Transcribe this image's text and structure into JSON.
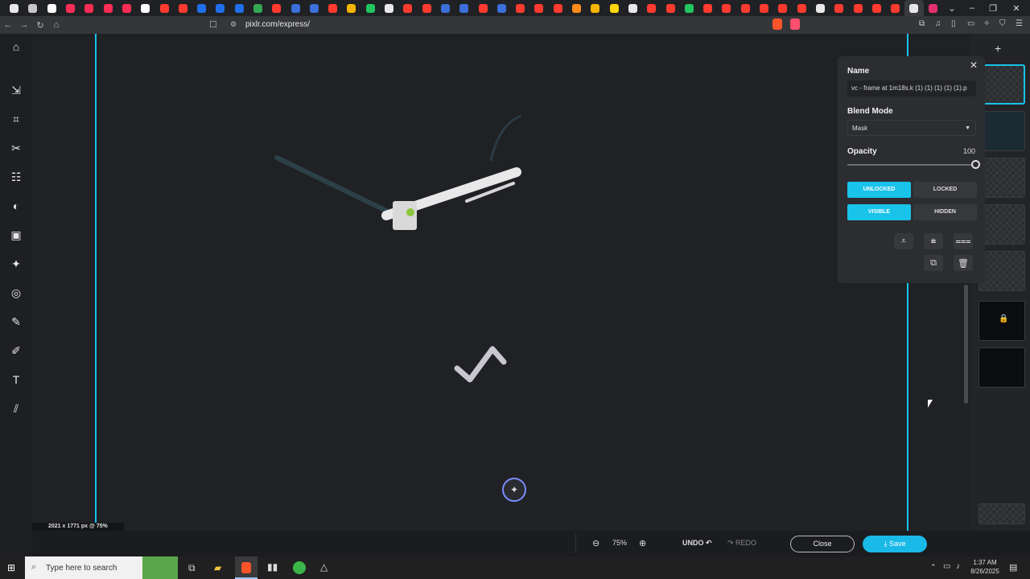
{
  "browser": {
    "url": "pixlr.com/express/",
    "tab_colors": [
      "#e8e8e8",
      "#c6c6c6",
      "#ffffff",
      "#ff2d55",
      "#ff2d55",
      "#ff2d55",
      "#ff2d55",
      "#ffffff",
      "#ff3b30",
      "#ff3b30",
      "#1f6feb",
      "#1f6feb",
      "#1f6feb",
      "#34a853",
      "#ff3b30",
      "#3b6fd9",
      "#3b6fd9",
      "#ff3b30",
      "#f4b400",
      "#22c55e",
      "#e8e8e8",
      "#ff3b30",
      "#ff3b30",
      "#3b6fd9",
      "#3b6fd9",
      "#ff3b30",
      "#3b6fd9",
      "#ff3b30",
      "#ff3b30",
      "#ff3b30",
      "#ff8c1a",
      "#f4b400",
      "#ffd60a",
      "#e8e8e8",
      "#ff3b30",
      "#ff3b30",
      "#22c55e",
      "#ff3b30",
      "#ff3b30",
      "#ff3b30",
      "#ff3b30",
      "#ff3b30",
      "#ff3b30",
      "#e8e8e8",
      "#ff3b30",
      "#ff3b30",
      "#ff3b30",
      "#ff3b30",
      "#e8e8e8",
      "#e1306c"
    ]
  },
  "canvas": {
    "dimensions_label": "2021 x 1771 px @ 75%"
  },
  "panel": {
    "name_label": "Name",
    "name_value": "vc - frame at 1m18s.k (1) (1) (1) (1) (1).p",
    "blend_label": "Blend Mode",
    "blend_value": "Mask",
    "opacity_label": "Opacity",
    "opacity_value": "100",
    "opacity_level": 1.0,
    "unlocked": "UNLOCKED",
    "locked": "LOCKED",
    "visible": "VISIBLE",
    "hidden": "HIDDEN"
  },
  "bottombar": {
    "zoom": "75%",
    "undo": "UNDO",
    "redo": "REDO",
    "close": "Close",
    "save": "Save"
  },
  "taskbar": {
    "search_placeholder": "Type here to search",
    "time": "1:37 AM",
    "date": "8/26/2025"
  },
  "colors": {
    "accent": "#19c3ea",
    "panel_bg": "#2c2d31"
  }
}
